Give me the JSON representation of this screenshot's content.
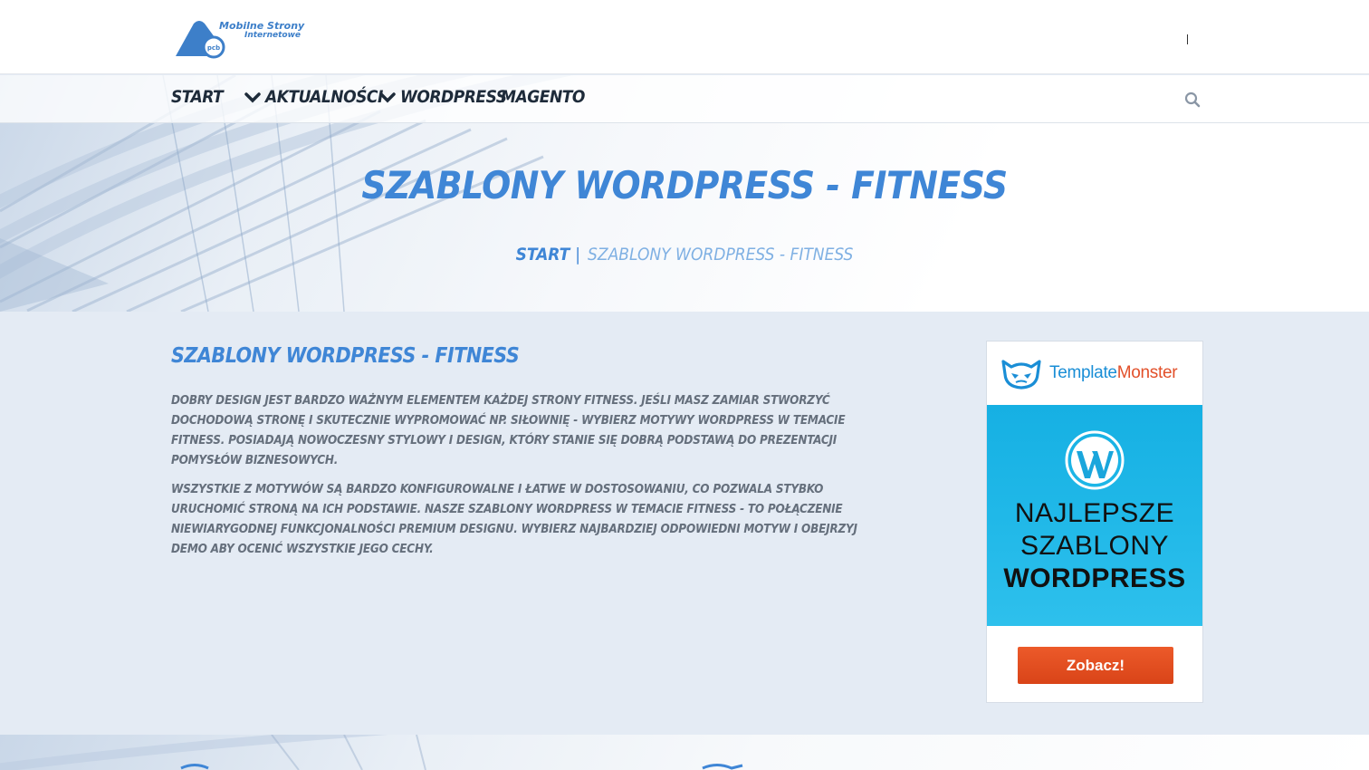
{
  "header": {
    "logo": {
      "line1": "Mobilne Strony",
      "line2": "Internetowe",
      "badge": "pcb",
      "icon": "cloud-phone-logo"
    }
  },
  "nav": {
    "items": [
      {
        "label": "START",
        "has_dropdown": false
      },
      {
        "label": "AKTUALNOŚCI",
        "has_dropdown": true
      },
      {
        "label": "WORDPRESS",
        "has_dropdown": true
      },
      {
        "label": "MAGENTO",
        "has_dropdown": false
      }
    ],
    "search_icon": "search-icon"
  },
  "hero": {
    "title": "SZABLONY WORDPRESS - FITNESS",
    "breadcrumb": {
      "home": "START",
      "separator": "|",
      "current": "SZABLONY WORDPRESS - FITNESS"
    }
  },
  "main": {
    "title": "SZABLONY WORDPRESS - FITNESS",
    "paragraphs": [
      "Dobry design jest bardzo ważnym elementem każdej strony fitness. Jeśli masz zamiar stworzyć dochodową stronę i skutecznie wypromować np. siłownię - wybierz motywy WordPress w temacie fitness. Posiadają nowoczesny stylowy i design, który stanie się dobrą podstawą do prezentacji pomysłów biznesowych.",
      "Wszystkie z motywów są bardzo konfigurowalne i łatwe w dostosowaniu, co pozwala stybko uruchomić stroną na ich podstawie. Nasze szablony WordPress w temacie fitness - to połączenie niewiarygodnej funkcjonalności premium designu. Wybierz najbardziej odpowiedni motyw i obejrzyj demo aby ocenić wszystkie jego cechy."
    ]
  },
  "ad": {
    "brand_part1": "Template",
    "brand_part2": "Monster",
    "line1": "NAJLEPSZE",
    "line2": "SZABLONY",
    "line3": "WORDPRESS",
    "button": "Zobacz!",
    "colors": {
      "brand_blue": "#1a8ed6",
      "brand_orange": "#e2502a",
      "banner": "#1fb6e6",
      "button": "#e04d1f"
    }
  },
  "colors": {
    "accent": "#3f86d6",
    "text": "#656f7c",
    "nav_text": "#1e2b3a",
    "background": "#e4ebf4"
  }
}
